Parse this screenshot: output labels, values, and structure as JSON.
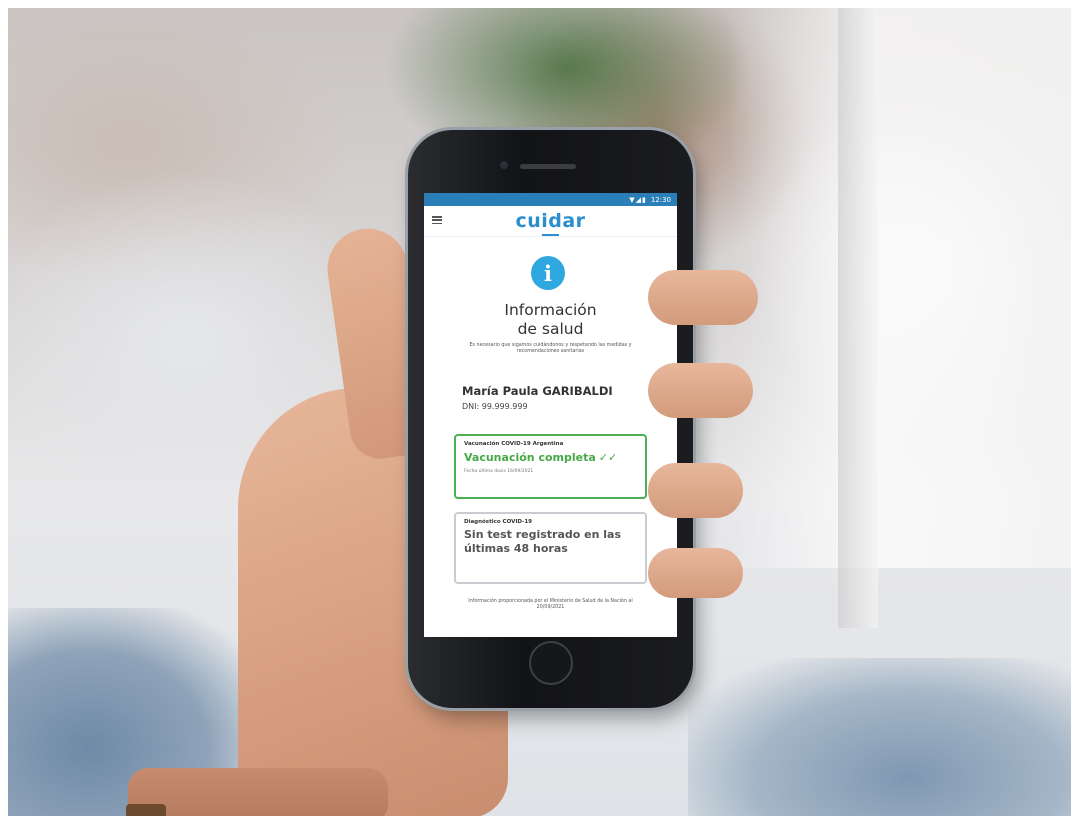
{
  "status_bar": {
    "time": "12:30"
  },
  "app": {
    "brand": "cuidar"
  },
  "info": {
    "title_line1": "Información",
    "title_line2": "de salud",
    "subtitle": "Es necesario que sigamos cuidándonos y respetando las medidas y recomendaciones sanitarias"
  },
  "person": {
    "name": "María Paula GARIBALDI",
    "dni": "DNI: 99.999.999"
  },
  "vaccination_card": {
    "label": "Vacunación COVID-19 Argentina",
    "status": "Vacunación completa",
    "date": "Fecha última dosis 16/09/2021"
  },
  "diagnostic_card": {
    "label": "Diagnóstico COVID-19",
    "status": "Sin test registrado en las últimas 48 horas"
  },
  "footer": {
    "note": "Información proporcionada por el Ministerio de Salud de la Nación al 20/09/2021"
  },
  "colors": {
    "brand": "#2a8ecf",
    "status_bar": "#2a7fb8",
    "success": "#46a846",
    "info_icon": "#2fa8e0"
  },
  "icons": [
    "menu-icon",
    "info-icon",
    "check-icon",
    "wifi-icon",
    "signal-icon",
    "battery-icon"
  ]
}
